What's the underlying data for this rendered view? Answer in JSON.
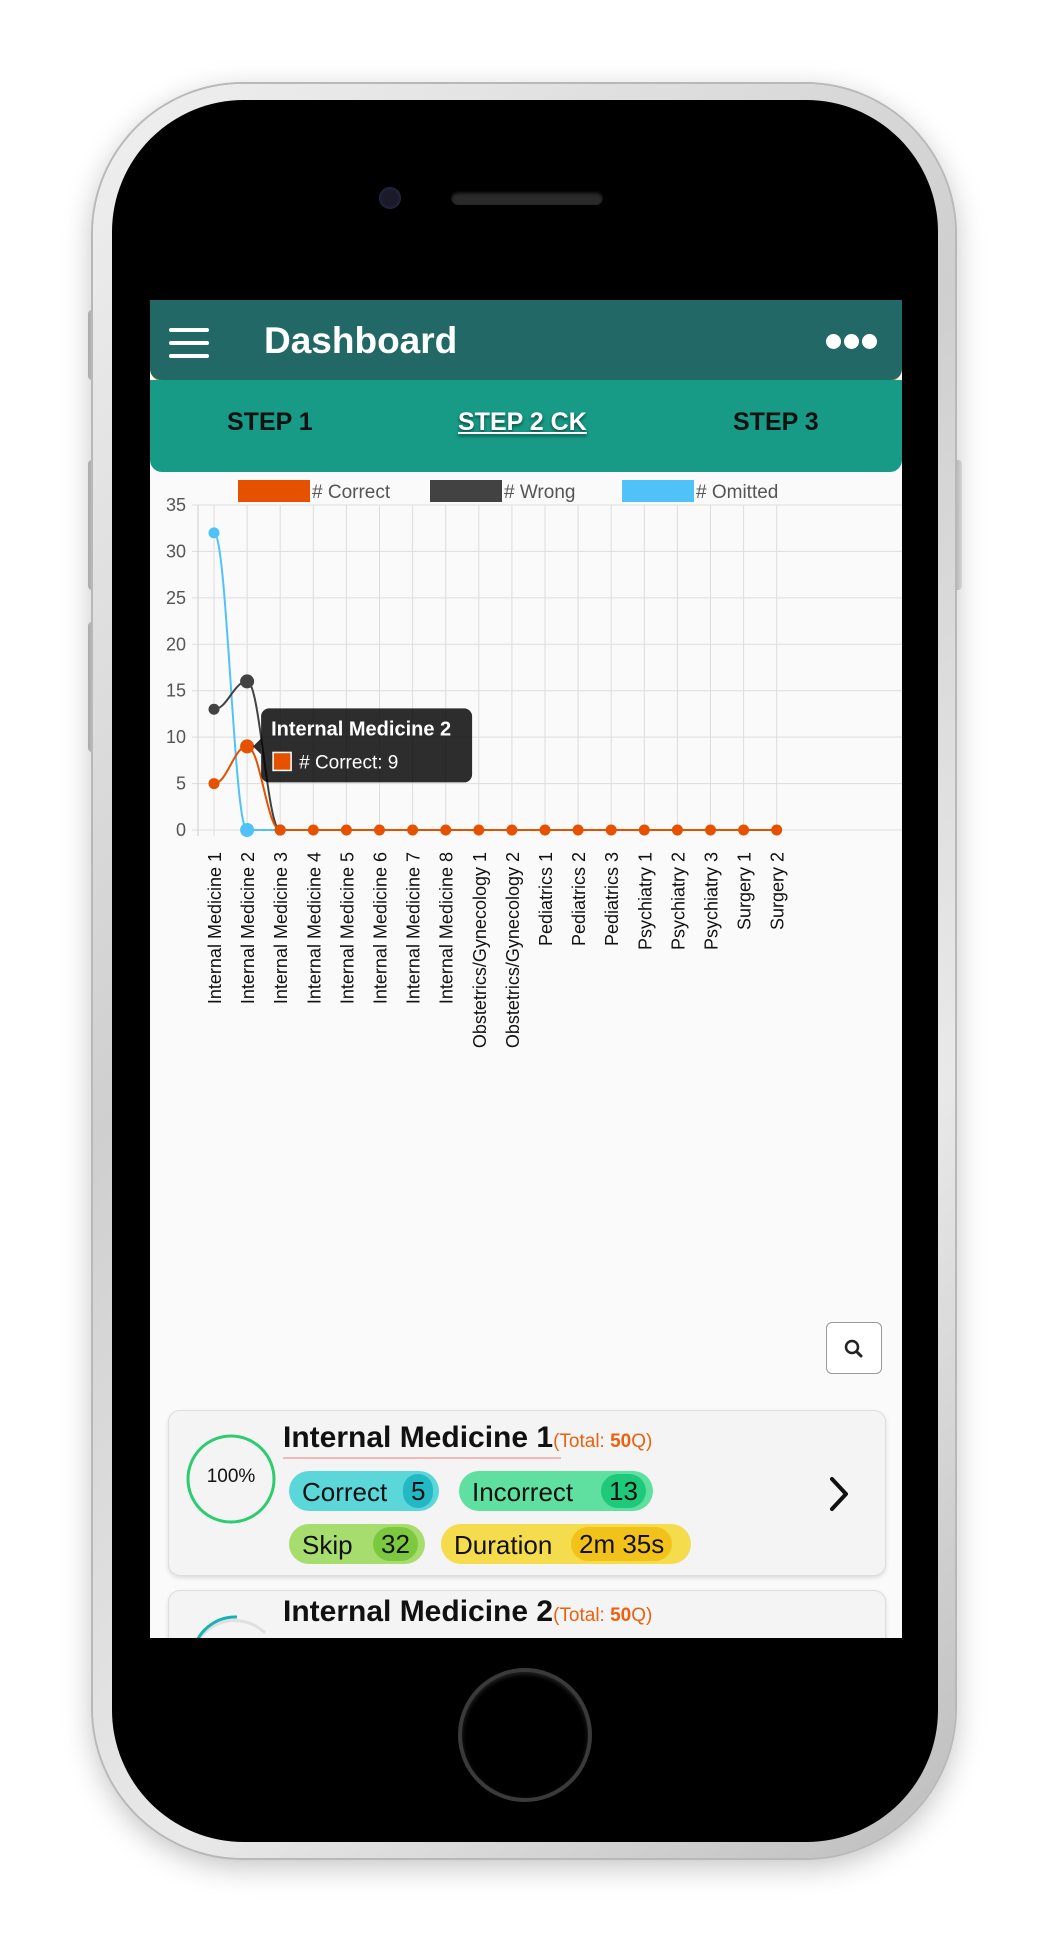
{
  "app": {
    "title": "Dashboard",
    "menu_icon": "hamburger-menu-icon",
    "more_icon": "more-dots-icon"
  },
  "tabs": [
    {
      "label": "STEP 1",
      "active": false
    },
    {
      "label": "STEP 2 CK",
      "active": true
    },
    {
      "label": "STEP 3",
      "active": false
    }
  ],
  "colors": {
    "appbar": "#216866",
    "tabbar": "#179a86",
    "correct": "#e65100",
    "wrong": "#424242",
    "omitted": "#4fc3f7",
    "accent_total": "#e8620f"
  },
  "chart_data": {
    "type": "line",
    "legend_position": "top",
    "grid": true,
    "ylim": [
      0,
      35
    ],
    "yticks": [
      "0",
      "5",
      "10",
      "15",
      "20",
      "25",
      "30",
      "35"
    ],
    "categories": [
      "Internal Medicine 1",
      "Internal Medicine 2",
      "Internal Medicine 3",
      "Internal Medicine 4",
      "Internal Medicine 5",
      "Internal Medicine 6",
      "Internal Medicine 7",
      "Internal Medicine 8",
      "Obstetrics/Gynecology 1",
      "Obstetrics/Gynecology 2",
      "Pediatrics 1",
      "Pediatrics 2",
      "Pediatrics 3",
      "Psychiatry 1",
      "Psychiatry 2",
      "Psychiatry 3",
      "Surgery 1",
      "Surgery 2"
    ],
    "series": [
      {
        "name": "# Correct",
        "color": "#e65100",
        "values": [
          5,
          9,
          0,
          0,
          0,
          0,
          0,
          0,
          0,
          0,
          0,
          0,
          0,
          0,
          0,
          0,
          0,
          0
        ]
      },
      {
        "name": "# Wrong",
        "color": "#424242",
        "values": [
          13,
          16,
          0,
          null,
          null,
          null,
          null,
          null,
          null,
          null,
          null,
          null,
          null,
          null,
          null,
          null,
          null,
          null
        ]
      },
      {
        "name": "# Omitted",
        "color": "#4fc3f7",
        "values": [
          32,
          0,
          0,
          null,
          null,
          null,
          null,
          null,
          null,
          null,
          null,
          null,
          null,
          null,
          null,
          null,
          null,
          null
        ]
      }
    ],
    "tooltip": {
      "title": "Internal Medicine 2",
      "label": "# Correct: 9",
      "category_index": 1,
      "series_index": 0
    }
  },
  "search_icon": "search-icon",
  "cards": [
    {
      "title": "Internal Medicine 1",
      "total_prefix": "(Total: ",
      "total_value": "50",
      "total_suffix": "Q)",
      "percent": "100%",
      "ring_fraction": 1.0,
      "correct_label": "Correct",
      "correct": "5",
      "incorrect_label": "Incorrect",
      "incorrect": "13",
      "skip_label": "Skip",
      "skip": "32",
      "duration_label": "Duration",
      "duration": "2m 35s"
    },
    {
      "title": "Internal Medicine 2",
      "total_prefix": "(Total: ",
      "total_value": "50",
      "total_suffix": "Q)"
    }
  ]
}
